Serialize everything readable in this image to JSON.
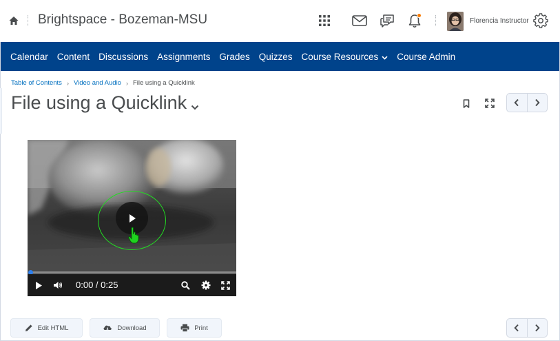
{
  "header": {
    "org_name": "Brightspace - Bozeman-MSU",
    "user_name": "Florencia Instructor",
    "icons": [
      "home-icon",
      "waffle-icon",
      "mail-icon",
      "chat-icon",
      "bell-icon",
      "gear-icon"
    ],
    "notification_color": "#f97b00"
  },
  "navbar": {
    "background": "#00438b",
    "items": [
      {
        "label": "Calendar"
      },
      {
        "label": "Content"
      },
      {
        "label": "Discussions"
      },
      {
        "label": "Assignments"
      },
      {
        "label": "Grades"
      },
      {
        "label": "Quizzes"
      },
      {
        "label": "Course Resources",
        "dropdown": true
      },
      {
        "label": "Course Admin"
      }
    ]
  },
  "breadcrumb": {
    "items": [
      "Table of Contents",
      "Video and Audio"
    ],
    "current": "File using a Quicklink"
  },
  "page": {
    "title": "File using a Quicklink"
  },
  "video": {
    "time": "0:00 / 0:25",
    "progress": 0
  },
  "actions": {
    "edit_html": "Edit HTML",
    "download": "Download",
    "print": "Print"
  }
}
